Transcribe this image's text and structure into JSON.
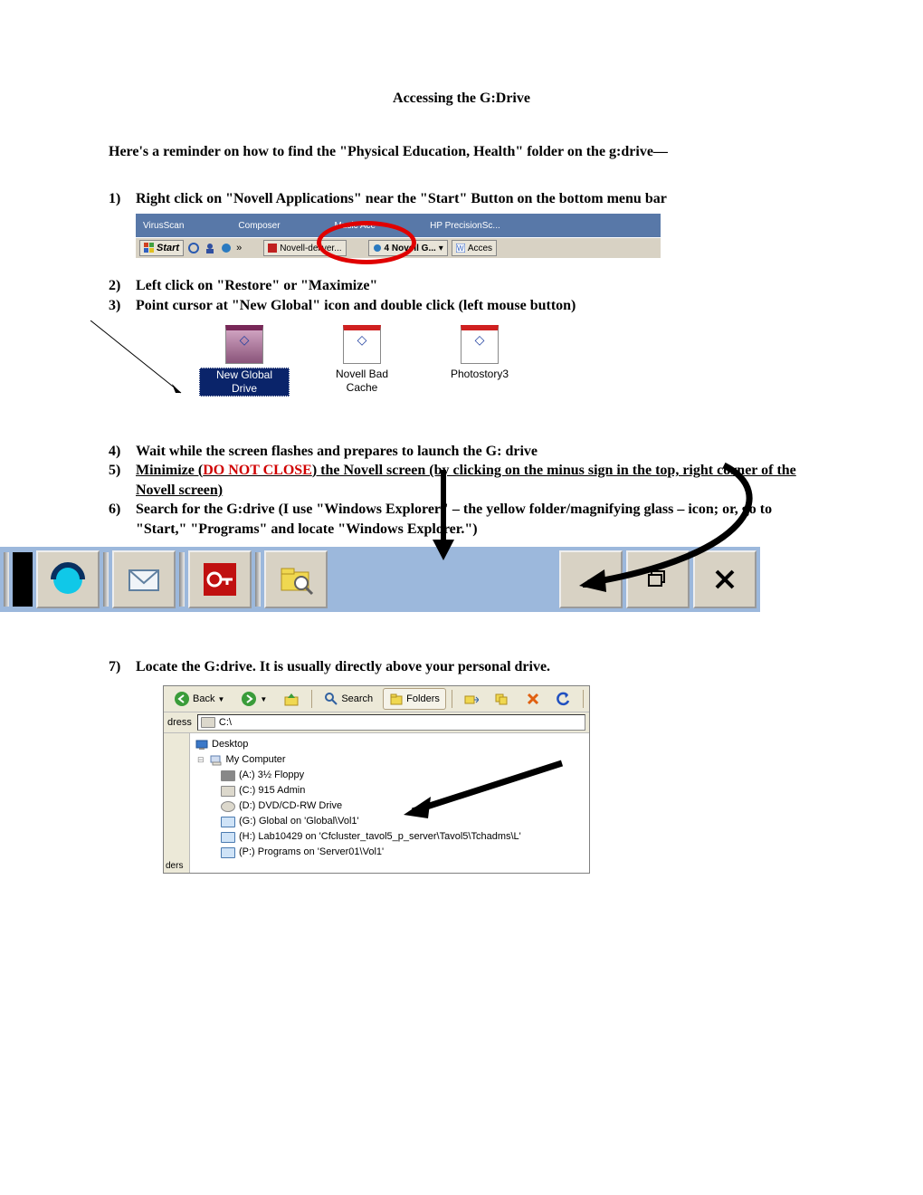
{
  "title": "Accessing the G:Drive",
  "intro": "Here's a reminder on how to find the \"Physical Education, Health\" folder on the g:drive—",
  "steps": {
    "s1": "Right click on \"Novell Applications\" near the \"Start\" Button on the bottom menu bar",
    "s2": "Left click on \"Restore\" or \"Maximize\"",
    "s3": "Point cursor at \"New Global\" icon and double click (left mouse button)",
    "s4": "Wait while the screen flashes and prepares to launch the G: drive",
    "s5a": "Minimize (",
    "s5b": "DO NOT CLOSE",
    "s5c": ") the Novell screen (by clicking on the minus sign in the top, right corner of the Novell screen)",
    "s6": "Search for the G:drive (I use \"Windows Explorer\" – the yellow folder/magnifying glass – icon; or, go to \"Start,\" \"Programs\" and locate \"Windows Explorer.\")",
    "s7": "Locate the G:drive.  It is usually directly above your personal drive."
  },
  "fig1": {
    "top_items": [
      "VirusScan",
      "Composer",
      "Music Ace",
      "HP PrecisionSc..."
    ],
    "start": "Start",
    "chevrons": "»",
    "task1": "Novell-deliver...",
    "task2": "4 Novell G...",
    "task3": "Acces"
  },
  "fig2": {
    "icons": [
      {
        "label": "New Global Drive",
        "selected": true
      },
      {
        "label": "Novell Bad Cache",
        "selected": false
      },
      {
        "label": "Photostory3",
        "selected": false
      }
    ]
  },
  "fig4": {
    "back": "Back",
    "search": "Search",
    "folders": "Folders",
    "addr_label": "dress",
    "addr_value": "C:\\",
    "folders_tab": "ders",
    "tree": {
      "root": "Desktop",
      "mycomp": "My Computer",
      "a": "(A:) 3½ Floppy",
      "c": "(C:) 915 Admin",
      "d": "(D:) DVD/CD-RW Drive",
      "g": "(G:) Global on 'Global\\Vol1'",
      "h": "(H:) Lab10429 on 'Cfcluster_tavol5_p_server\\Tavol5\\Tchadms\\L'",
      "p": "(P:) Programs on 'Server01\\Vol1'"
    }
  }
}
